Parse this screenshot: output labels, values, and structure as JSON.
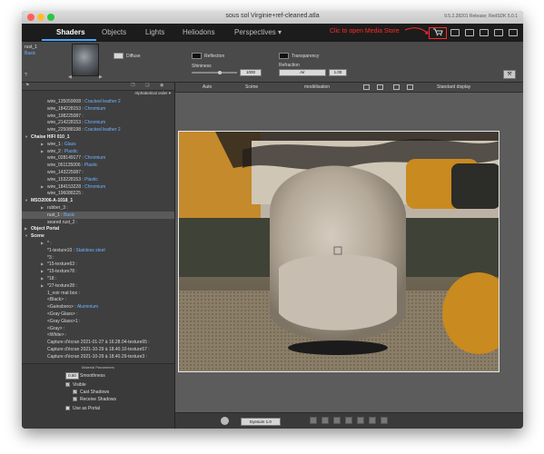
{
  "window": {
    "title": "sous sol Virginie+ref-cleaned.atla",
    "version": "9.5.2.28201 Release; RedSDK 5.0.1"
  },
  "nav": {
    "tabs": [
      {
        "label": "Shaders"
      },
      {
        "label": "Objects"
      },
      {
        "label": "Lights"
      },
      {
        "label": "Heliodons"
      },
      {
        "label": "Perspectives ▾"
      }
    ],
    "annotation": "Clic to open Media Store"
  },
  "material": {
    "name": "rust_1",
    "type": "Basic",
    "help": "?",
    "diffuse_label": "Diffuse",
    "reflection_label": "Reflection",
    "transparency_label": "Transparency",
    "shininess_label": "Shininess",
    "shininess_value": "1000",
    "shininess_level": 0.62,
    "refraction_label": "Refraction",
    "refraction_medium": "Air",
    "refraction_value": "1.00",
    "colors": {
      "diffuse": "#d8d8d8",
      "reflection": "#111111",
      "transparency": "#111111"
    }
  },
  "tree": {
    "sort": "Alphabetical order ▾",
    "rows": [
      {
        "indent": 1,
        "name": "wire_135059008",
        "material": "Cracked leather 2"
      },
      {
        "indent": 1,
        "name": "wire_184228153",
        "material": "Chromium"
      },
      {
        "indent": 1,
        "name": "wire_198225087",
        "material": ""
      },
      {
        "indent": 1,
        "name": "wire_214228153",
        "material": "Chromium"
      },
      {
        "indent": 1,
        "name": "wire_225088198",
        "material": "Cracked leather 2"
      },
      {
        "indent": 0,
        "name": "Chaise HIFI 010_1",
        "material": "",
        "bold": true,
        "arrow": "▼"
      },
      {
        "indent": 1,
        "name": "wire_1",
        "material": "Glass",
        "arrow": "▶"
      },
      {
        "indent": 1,
        "name": "wire_2",
        "material": "Plastic",
        "arrow": "▶"
      },
      {
        "indent": 1,
        "name": "wire_028149177",
        "material": "Chromium"
      },
      {
        "indent": 1,
        "name": "wire_061135006",
        "material": "Plastic"
      },
      {
        "indent": 1,
        "name": "wire_143225087",
        "material": ""
      },
      {
        "indent": 1,
        "name": "wire_153228153",
        "material": "Plastic"
      },
      {
        "indent": 1,
        "name": "wire_184153228",
        "material": "Chromium",
        "arrow": "▶"
      },
      {
        "indent": 1,
        "name": "wire_196088225",
        "material": ""
      },
      {
        "indent": 0,
        "name": "MSO2006-A-1018_1",
        "material": "",
        "bold": true,
        "arrow": "▼"
      },
      {
        "indent": 1,
        "name": "rubber_3",
        "material": "",
        "arrow": "▶"
      },
      {
        "indent": 1,
        "name": "rust_1",
        "material": "Basic",
        "selected": true
      },
      {
        "indent": 1,
        "name": "seared rust_2",
        "material": ""
      },
      {
        "indent": 0,
        "name": "Object Portal",
        "material": "",
        "bold": true,
        "arrow": "▶"
      },
      {
        "indent": 0,
        "name": "Scene",
        "material": "",
        "bold": true,
        "arrow": "▼"
      },
      {
        "indent": 1,
        "name": "*",
        "material": "",
        "arrow": "▶"
      },
      {
        "indent": 1,
        "name": "*1-texture10",
        "material": "Stainless steel"
      },
      {
        "indent": 1,
        "name": "*3",
        "material": ""
      },
      {
        "indent": 1,
        "name": "*15-texture63",
        "material": "",
        "arrow": "▶"
      },
      {
        "indent": 1,
        "name": "*15-texture78",
        "material": "",
        "arrow": "▶"
      },
      {
        "indent": 1,
        "name": "*18",
        "material": "",
        "arrow": "▶"
      },
      {
        "indent": 1,
        "name": "*27-texture28",
        "material": "",
        "arrow": "▶"
      },
      {
        "indent": 1,
        "name": "1_noir mat box",
        "material": ""
      },
      {
        "indent": 1,
        "name": "<Black>",
        "material": ""
      },
      {
        "indent": 1,
        "name": "<Gainsboro>",
        "material": "Aluminium"
      },
      {
        "indent": 1,
        "name": "<Gray Glass>",
        "material": ""
      },
      {
        "indent": 1,
        "name": "<Gray Glass>1",
        "material": ""
      },
      {
        "indent": 1,
        "name": "<Gray>",
        "material": ""
      },
      {
        "indent": 1,
        "name": "<White>",
        "material": ""
      },
      {
        "indent": 1,
        "name": "Capture d'écran 2021-01-27 à 16.28.04-texture65",
        "material": ""
      },
      {
        "indent": 1,
        "name": "Capture d'écran 2021-10-29 à 18.40.10-texture57",
        "material": ""
      },
      {
        "indent": 1,
        "name": "Capture d'écran 2021-10-29 à 18.40.29-texture3",
        "material": ""
      }
    ]
  },
  "params": {
    "title": "Material Parameters",
    "smoothness_value": "0.50",
    "smoothness_label": "Smoothness",
    "visible_label": "Visible",
    "cast_shadows_label": "Cast Shadows",
    "receive_shadows_label": "Receive Shadows",
    "use_as_portal_label": "Use as Portal",
    "check_mark": "✓"
  },
  "viewport": {
    "auto_label": "Auto",
    "scene_label": "Scène",
    "mode_label": "modélisation",
    "display_label": "Standard display"
  },
  "bottom": {
    "camera": "Eyesum 1.0"
  }
}
